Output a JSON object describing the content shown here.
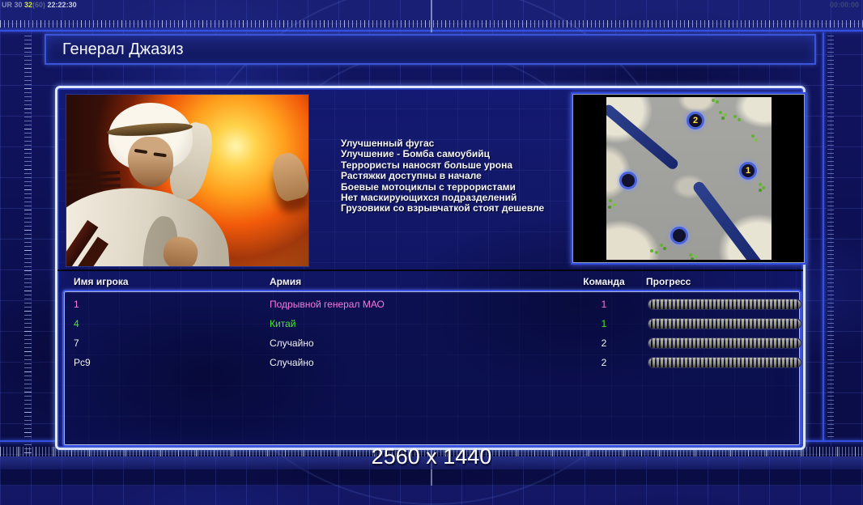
{
  "status_bar": {
    "left_prefix": "UR 30 ",
    "fps_value": "32",
    "fps_cap": "(60)",
    "clock": " 22:22:30",
    "match_timer": "00:00:00"
  },
  "header": {
    "title": "Генерал Джазиз"
  },
  "general_info": {
    "features": [
      "Улучшенный фугас",
      "Улучшение - Бомба самоубийц",
      "Террористы наносят больше урона",
      "Растяжки доступны в начале",
      "Боевые мотоциклы с террористами",
      "Нет маскирующихся подразделений",
      "Грузовики со взрывчаткой стоят дешевле"
    ]
  },
  "minimap": {
    "markers": [
      {
        "label": "2"
      },
      {
        "label": "1"
      },
      {
        "label": ""
      },
      {
        "label": ""
      }
    ]
  },
  "players": {
    "headers": {
      "name": "Имя игрока",
      "army": "Армия",
      "team": "Команда",
      "progress": "Прогресс"
    },
    "rows": [
      {
        "name": "1",
        "army": "Подрывной генерал МАО",
        "team": "1",
        "progress_percent": 100,
        "color": "#f57ade"
      },
      {
        "name": "4",
        "army": "Китай",
        "team": "1",
        "progress_percent": 100,
        "color": "#4ae82a"
      },
      {
        "name": "7",
        "army": "Случайно",
        "team": "2",
        "progress_percent": 100,
        "color": "#f2f2f2"
      },
      {
        "name": "Pc9",
        "army": "Случайно",
        "team": "2",
        "progress_percent": 100,
        "color": "#f2f2f2"
      }
    ]
  },
  "footer": {
    "resolution": "2560 x 1440"
  },
  "colors": {
    "accent_blue": "#3a55e8",
    "row_pink": "#f57ade",
    "row_green": "#4ae82a",
    "bar_segment": "#a2a292",
    "fps_highlight": "#d8e84a"
  }
}
